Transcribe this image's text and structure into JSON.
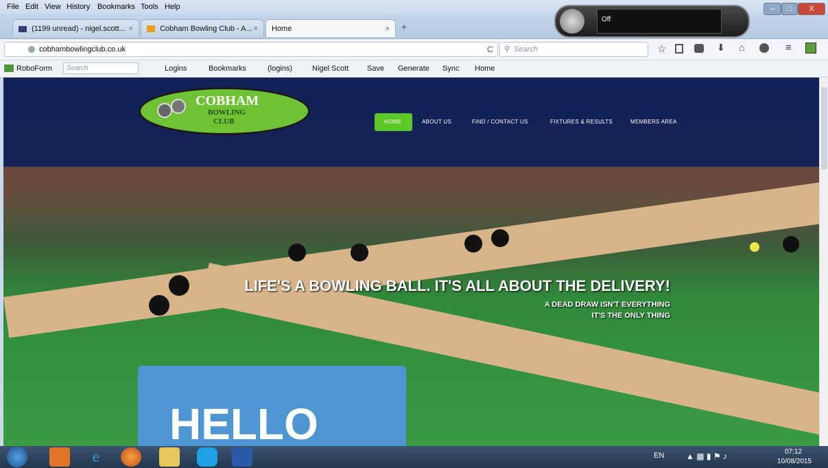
{
  "menu": [
    "File",
    "Edit",
    "View",
    "History",
    "Bookmarks",
    "Tools",
    "Help"
  ],
  "tabs": [
    {
      "label": "(1199 unread) - nigel.scott...",
      "close": "×"
    },
    {
      "label": "Cobham Bowling Club - A...",
      "close": "×"
    },
    {
      "label": "Home",
      "close": "×"
    }
  ],
  "new_tab": "+",
  "speech": {
    "status": "Off"
  },
  "window_controls": {
    "minimize": "–",
    "maximize": "□",
    "close": "X"
  },
  "nav": {
    "url": "cobhambowlingclub.co.uk",
    "search_placeholder": "Search",
    "reload": "C"
  },
  "bookmarks": {
    "roboform": "RoboForm",
    "search_placeholder": "Search",
    "items": [
      "Logins",
      "Bookmarks",
      "(logins)",
      "Nigel Scott",
      "Save",
      "Generate",
      "Sync",
      "Home"
    ]
  },
  "site": {
    "logo": {
      "line1": "COBHAM",
      "line2": "BOWLING",
      "line3": "CLUB"
    },
    "menu": [
      "HOME",
      "ABOUT US",
      "FIND / CONTACT US",
      "FIXTURES & RESULTS",
      "MEMBERS AREA"
    ],
    "headline": "LIFE'S A BOWLING BALL. IT'S ALL ABOUT THE DELIVERY!",
    "subline1": "A DEAD DRAW ISN'T EVERYTHING",
    "subline2": "IT'S THE ONLY THING",
    "hello": "HELLO"
  },
  "taskbar": {
    "lang": "EN",
    "time": "07:12",
    "date": "10/08/2015"
  },
  "colors": {
    "accent_green": "#5cc827",
    "header_blue": "#0a1e5a",
    "hello_blue": "#4d96d1"
  }
}
